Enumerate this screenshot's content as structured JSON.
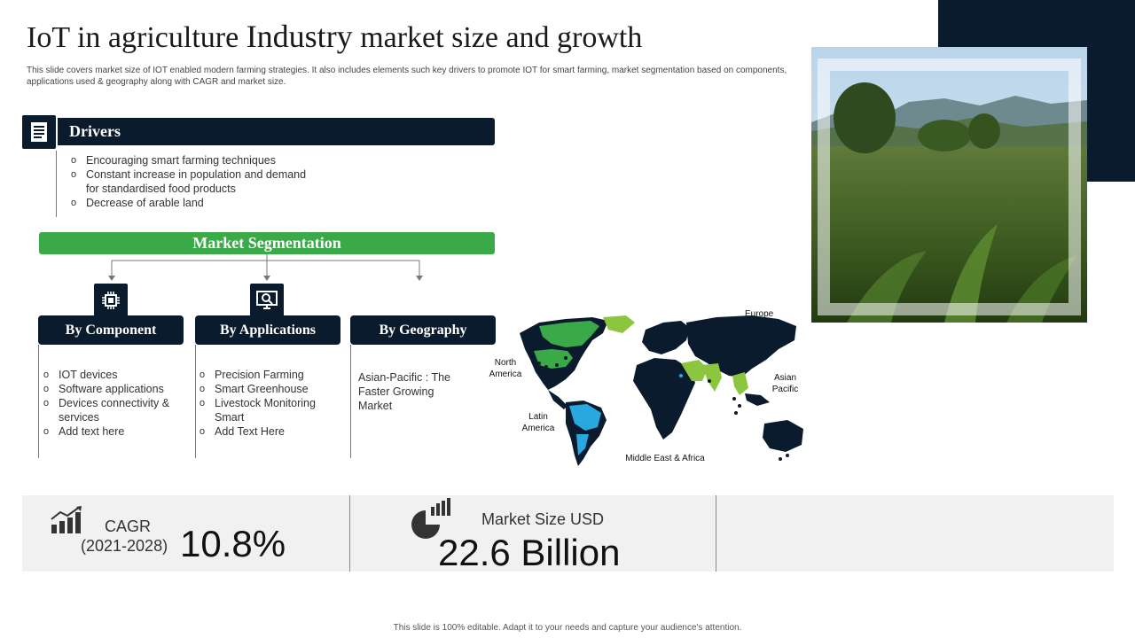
{
  "title": {
    "part1": "IoT in agriculture ",
    "part2": "Industry",
    "part3": " market size and growth"
  },
  "subtitle": "This slide covers market size of IOT enabled modern farming strategies. It also includes elements such key drivers to promote IOT for smart farming, market segmentation based on components, applications used & geography along with CAGR and market size.",
  "drivers": {
    "heading": "Drivers",
    "icon": "document-icon",
    "items": [
      "Encouraging smart farming techniques",
      "Constant increase in population and demand for standardised food products",
      "Decrease of arable land"
    ]
  },
  "segmentation": {
    "heading": "Market Segmentation",
    "component": {
      "heading": "By Component",
      "icon": "chip-icon",
      "items": [
        "IOT devices",
        "Software applications",
        "Devices connectivity & services",
        "Add text here"
      ]
    },
    "applications": {
      "heading": "By Applications",
      "icon": "monitor-search-icon",
      "items": [
        "Precision Farming",
        "Smart Greenhouse",
        "Livestock Monitoring Smart",
        "Add Text Here"
      ]
    },
    "geography": {
      "heading": "By Geography",
      "text": "Asian-Pacific : The Faster Growing Market"
    }
  },
  "map": {
    "regions": {
      "europe": "Europe",
      "north_america": "North America",
      "asian_pacific": "Asian Pacific",
      "latin_america": "Latin America",
      "mea": "Middle East & Africa"
    },
    "colors": {
      "land": "#0b1b2e",
      "highlight_green": "#3aaa49",
      "highlight_light_green": "#8cc63f",
      "highlight_blue": "#29a8e0"
    }
  },
  "stats": {
    "cagr_label": "CAGR",
    "cagr_years": "(2021-2028)",
    "cagr_value": "10.8%",
    "market_size_label": "Market Size USD",
    "market_size_value": "22.6 Billion",
    "icons": [
      "growth-chart-icon",
      "pie-bars-icon"
    ]
  },
  "footer": "This slide is 100% editable. Adapt it to your needs and capture your audience's attention.",
  "colors": {
    "navy": "#0b1b2e",
    "green": "#3aaa49",
    "panel": "#f1f1f1"
  }
}
